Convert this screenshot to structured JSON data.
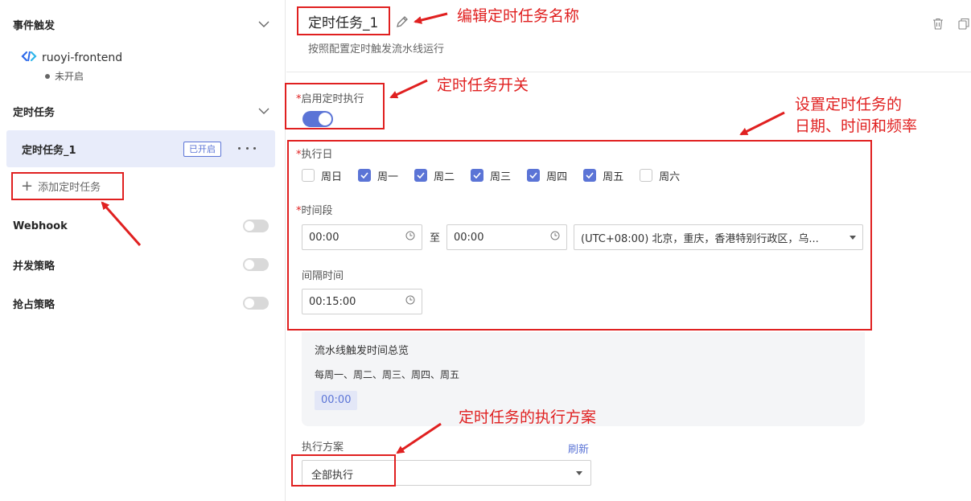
{
  "sidebar": {
    "event_trigger": {
      "title": "事件触发"
    },
    "source": {
      "name": "ruoyi-frontend",
      "status": "未开启"
    },
    "scheduled": {
      "title": "定时任务"
    },
    "task": {
      "name": "定时任务_1",
      "badge": "已开启"
    },
    "add_task_label": "添加定时任务",
    "webhook": {
      "label": "Webhook",
      "enabled": false
    },
    "concurrency": {
      "label": "并发策略",
      "enabled": false
    },
    "preemption": {
      "label": "抢占策略",
      "enabled": false
    }
  },
  "main": {
    "title": "定时任务_1",
    "subtitle": "按照配置定时触发流水线运行",
    "enable_field": {
      "star": "*",
      "label": "启用定时执行",
      "enabled": true
    },
    "days_field": {
      "star": "*",
      "label": "执行日",
      "days": [
        {
          "label": "周日",
          "checked": false
        },
        {
          "label": "周一",
          "checked": true
        },
        {
          "label": "周二",
          "checked": true
        },
        {
          "label": "周三",
          "checked": true
        },
        {
          "label": "周四",
          "checked": true
        },
        {
          "label": "周五",
          "checked": true
        },
        {
          "label": "周六",
          "checked": false
        }
      ]
    },
    "time_field": {
      "star": "*",
      "label": "时间段",
      "start": "00:00",
      "separator": "至",
      "end": "00:00",
      "timezone": "(UTC+08:00) 北京，重庆，香港特别行政区，乌..."
    },
    "interval_field": {
      "label": "间隔时间",
      "value": "00:15:00"
    },
    "overview": {
      "title": "流水线触发时间总览",
      "days": "每周一、周二、周三、周四、周五",
      "time": "00:00"
    },
    "plan_field": {
      "label": "执行方案",
      "refresh": "刷新",
      "value": "全部执行"
    }
  },
  "annotations": {
    "edit_name": "编辑定时任务名称",
    "switch": "定时任务开关",
    "schedule_line1": "设置定时任务的",
    "schedule_line2": "日期、时间和频率",
    "plan": "定时任务的执行方案"
  },
  "colors": {
    "accent": "#5b74d6",
    "annotation": "#e02020"
  }
}
